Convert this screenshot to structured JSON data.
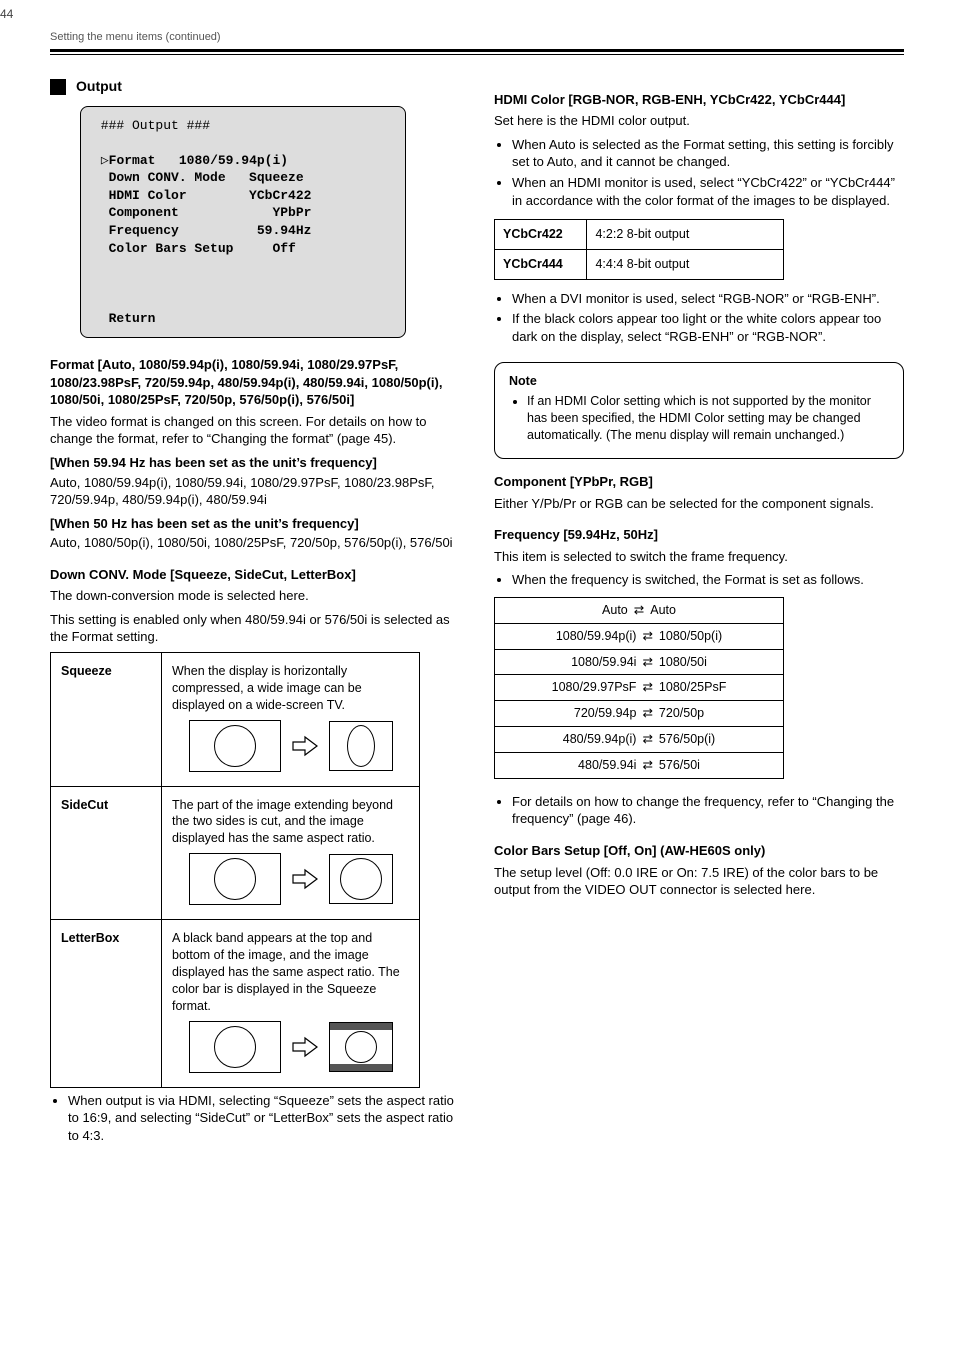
{
  "page": {
    "number": "44",
    "header": "Setting the menu items (continued)"
  },
  "sections": {
    "output": {
      "title": "Output"
    }
  },
  "osd": {
    "header": " ### Output ###",
    "cursor": "▷",
    "rows": [
      {
        "left": "Format",
        "right": "1080/59.94p(i)"
      },
      {
        "left": "Down CONV. Mode",
        "right": "Squeeze"
      },
      {
        "left": "HDMI Color",
        "right": "YCbCr422"
      },
      {
        "left": "Component",
        "right": "YPbPr"
      },
      {
        "left": "Frequency",
        "right": "59.94Hz"
      },
      {
        "left": "Color Bars Setup",
        "right": "Off"
      }
    ],
    "return": "Return"
  },
  "left": {
    "format": {
      "heading": "Format [Auto, 1080/59.94p(i), 1080/59.94i, 1080/29.97PsF, 1080/23.98PsF, 720/59.94p, 480/59.94p(i), 480/59.94i, 1080/50p(i), 1080/50i, 1080/25PsF, 720/50p, 576/50p(i), 576/50i]",
      "desc": "The video format is changed on this screen. For details on how to change the format, refer to “Changing the format” (page 45).",
      "group59": {
        "label": "[When 59.94 Hz has been set as the unit’s frequency]",
        "options": "Auto, 1080/59.94p(i), 1080/59.94i, 1080/29.97PsF, 1080/23.98PsF, 720/59.94p, 480/59.94p(i), 480/59.94i"
      },
      "group50": {
        "label": "[When 50 Hz has been set as the unit’s frequency]",
        "options": "Auto, 1080/50p(i), 1080/50i, 1080/25PsF, 720/50p, 576/50p(i), 576/50i"
      }
    },
    "dconv": {
      "heading": "Down CONV. Mode [Squeeze, SideCut, LetterBox]",
      "desc1": "The down-conversion mode is selected here.",
      "desc2": "This setting is enabled only when 480/59.94i or 576/50i is selected as the Format setting.",
      "rows": [
        {
          "name": "Squeeze",
          "desc": "When the display is horizontally compressed, a wide image can be displayed on a wide-screen TV."
        },
        {
          "name": "SideCut",
          "desc": "The part of the image extending beyond the two sides is cut, and the image displayed has the same aspect ratio."
        },
        {
          "name": "LetterBox",
          "desc": "A black band appears at the top and bottom of the image, and the image displayed has the same aspect ratio. The color bar is displayed in the Squeeze format."
        }
      ],
      "footnote": "When output is via HDMI, selecting “Squeeze” sets the aspect ratio to 16:9, and selecting “SideCut” or “LetterBox” sets the aspect ratio to 4:3."
    }
  },
  "right": {
    "hdmi": {
      "heading": "HDMI Color [RGB-NOR, RGB-ENH, YCbCr422, YCbCr444]",
      "desc": "Set here is the HDMI color output.",
      "options": "",
      "bullets": [
        "When Auto is selected as the Format setting, this setting is forcibly set to Auto, and it cannot be changed.",
        "When an HDMI monitor is used, select “YCbCr422” or “YCbCr444” in accordance with the color format of the images to be displayed."
      ],
      "table": [
        [
          "YCbCr422",
          "4:2:2 8-bit output"
        ],
        [
          "YCbCr444",
          "4:4:4 8-bit output"
        ]
      ],
      "bullets2": [
        "When a DVI monitor is used, select “RGB-NOR” or “RGB-ENH”.",
        "If the black colors appear too light or the white colors appear too dark on the display, select “RGB-ENH” or “RGB-NOR”."
      ]
    },
    "note": {
      "heading": "Note",
      "text": "If an HDMI Color setting which is not supported by the monitor has been specified, the HDMI Color setting may be changed automatically. (The menu display will remain unchanged.)"
    },
    "component": {
      "heading": "Component [YPbPr, RGB]",
      "desc": "Either Y/Pb/Pr or RGB can be selected for the component signals.",
      "options": ""
    },
    "freq": {
      "heading": "Frequency [59.94Hz, 50Hz]",
      "desc": "This item is selected to switch the frame frequency.",
      "options": "",
      "bullets": [
        "When the frequency is switched, the Format is set as follows."
      ],
      "table": [
        {
          "left": "Auto",
          "right": "Auto"
        },
        {
          "left": "1080/59.94p(i)",
          "right": "1080/50p(i)"
        },
        {
          "left": "1080/59.94i",
          "right": "1080/50i"
        },
        {
          "left": "1080/29.97PsF",
          "right": "1080/25PsF"
        },
        {
          "left": "720/59.94p",
          "right": "720/50p"
        },
        {
          "left": "480/59.94p(i)",
          "right": "576/50p(i)"
        },
        {
          "left": "480/59.94i",
          "right": "576/50i"
        }
      ],
      "bullets2": [
        "For details on how to change the frequency, refer to “Changing the frequency” (page 46)."
      ]
    },
    "cbsetup": {
      "heading": "Color Bars Setup   [Off, On]   (AW-HE60S only)",
      "desc": "The setup level (Off: 0.0 IRE or On: 7.5 IRE) of the color bars to be output from the VIDEO OUT connector is selected here.",
      "options": ""
    }
  }
}
